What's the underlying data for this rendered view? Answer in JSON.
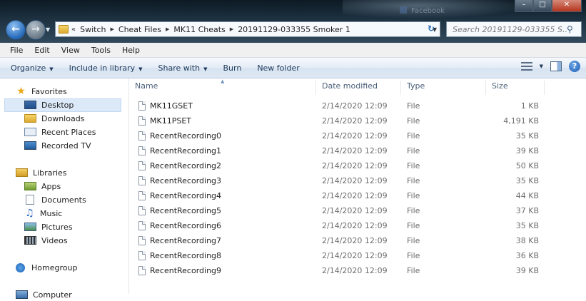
{
  "window": {
    "ghost_tab": "Facebook",
    "buttons": {
      "minimize": "–",
      "maximize": "□",
      "close": "✕"
    }
  },
  "address": {
    "prefix": "«",
    "crumbs": [
      "Switch",
      "Cheat Files",
      "MK11 Cheats",
      "20191129-033355 Smoker 1"
    ],
    "search_placeholder": "Search 20191129-033355 S..."
  },
  "menu": [
    "File",
    "Edit",
    "View",
    "Tools",
    "Help"
  ],
  "toolbar": {
    "organize": "Organize",
    "include_library": "Include in library",
    "share_with": "Share with",
    "burn": "Burn",
    "new_folder": "New folder"
  },
  "nav": {
    "favorites": "Favorites",
    "desktop": "Desktop",
    "downloads": "Downloads",
    "recent_places": "Recent Places",
    "recorded_tv": "Recorded TV",
    "libraries": "Libraries",
    "apps": "Apps",
    "documents": "Documents",
    "music": "Music",
    "pictures": "Pictures",
    "videos": "Videos",
    "homegroup": "Homegroup",
    "computer": "Computer"
  },
  "columns": {
    "name": "Name",
    "date": "Date modified",
    "type": "Type",
    "size": "Size"
  },
  "files": [
    {
      "name": "MK11GSET",
      "date": "2/14/2020 12:09",
      "type": "File",
      "size": "1 KB"
    },
    {
      "name": "MK11PSET",
      "date": "2/14/2020 12:09",
      "type": "File",
      "size": "4,191 KB"
    },
    {
      "name": "RecentRecording0",
      "date": "2/14/2020 12:09",
      "type": "File",
      "size": "35 KB"
    },
    {
      "name": "RecentRecording1",
      "date": "2/14/2020 12:09",
      "type": "File",
      "size": "39 KB"
    },
    {
      "name": "RecentRecording2",
      "date": "2/14/2020 12:09",
      "type": "File",
      "size": "50 KB"
    },
    {
      "name": "RecentRecording3",
      "date": "2/14/2020 12:09",
      "type": "File",
      "size": "35 KB"
    },
    {
      "name": "RecentRecording4",
      "date": "2/14/2020 12:09",
      "type": "File",
      "size": "44 KB"
    },
    {
      "name": "RecentRecording5",
      "date": "2/14/2020 12:09",
      "type": "File",
      "size": "37 KB"
    },
    {
      "name": "RecentRecording6",
      "date": "2/14/2020 12:09",
      "type": "File",
      "size": "35 KB"
    },
    {
      "name": "RecentRecording7",
      "date": "2/14/2020 12:09",
      "type": "File",
      "size": "38 KB"
    },
    {
      "name": "RecentRecording8",
      "date": "2/14/2020 12:09",
      "type": "File",
      "size": "36 KB"
    },
    {
      "name": "RecentRecording9",
      "date": "2/14/2020 12:09",
      "type": "File",
      "size": "39 KB"
    }
  ]
}
